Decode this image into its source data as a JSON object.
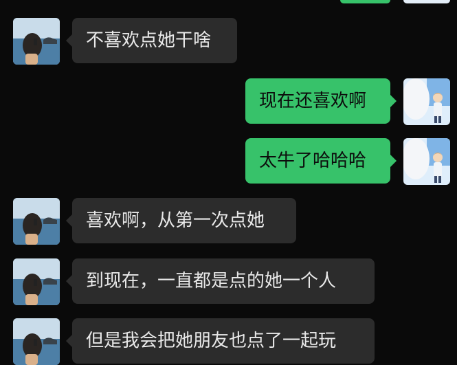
{
  "colors": {
    "background": "#0a0a0a",
    "incoming_bubble": "#2c2c2c",
    "outgoing_bubble": "#37c26a"
  },
  "messages": [
    {
      "side": "left",
      "text": "不喜欢点她干啥",
      "avatar": "girl-by-sea-avatar"
    },
    {
      "side": "right",
      "text": "现在还喜欢啊",
      "avatar": "anime-boy-avatar"
    },
    {
      "side": "right",
      "text": "太牛了哈哈哈",
      "avatar": "anime-boy-avatar"
    },
    {
      "side": "left",
      "text": "喜欢啊，从第一次点她",
      "avatar": "girl-by-sea-avatar"
    },
    {
      "side": "left",
      "text": "到现在，一直都是点的她一个人",
      "avatar": "girl-by-sea-avatar"
    },
    {
      "side": "left",
      "text": "但是我会把她朋友也点了一起玩",
      "avatar": "girl-by-sea-avatar"
    }
  ]
}
